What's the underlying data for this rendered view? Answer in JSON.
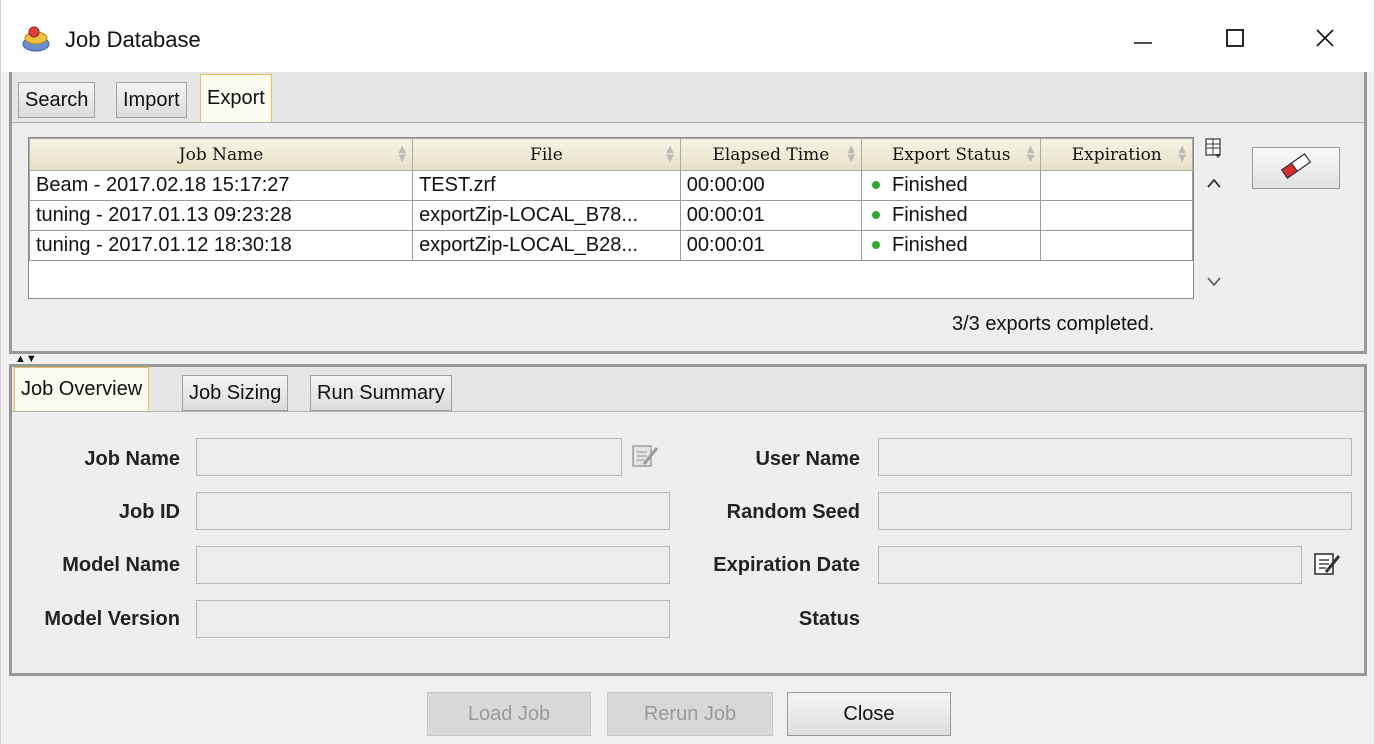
{
  "window": {
    "title": "Job Database",
    "icon": "app-icon",
    "controls": {
      "minimize": "—",
      "maximize": "☐",
      "close": "✕"
    }
  },
  "top_tabs": [
    {
      "label": "Search"
    },
    {
      "label": "Import"
    },
    {
      "label": "Export",
      "active": true
    }
  ],
  "export_table": {
    "columns": [
      "Job Name",
      "File",
      "Elapsed Time",
      "Export Status",
      "Expiration"
    ],
    "rows": [
      [
        "Beam - 2017.02.18 15:17:27",
        "TEST.zrf",
        "00:00:00",
        "Finished",
        ""
      ],
      [
        "tuning - 2017.01.13 09:23:28",
        "exportZip-LOCAL_B78...",
        "00:00:01",
        "Finished",
        ""
      ],
      [
        "tuning - 2017.01.12 18:30:18",
        "exportZip-LOCAL_B28...",
        "00:00:01",
        "Finished",
        ""
      ]
    ],
    "status_summary": "3/3 exports completed.",
    "status_color": "#2fa82f"
  },
  "bottom_tabs": [
    {
      "label": "Job Overview",
      "active": true
    },
    {
      "label": "Job Sizing"
    },
    {
      "label": "Run Summary"
    }
  ],
  "overview": {
    "job_name_label": "Job Name",
    "job_id_label": "Job ID",
    "model_name_label": "Model Name",
    "model_version_label": "Model Version",
    "user_name_label": "User Name",
    "random_seed_label": "Random Seed",
    "expiration_date_label": "Expiration Date",
    "status_label": "Status"
  },
  "footer": {
    "load_job": "Load Job",
    "rerun_job": "Rerun Job",
    "close": "Close"
  }
}
